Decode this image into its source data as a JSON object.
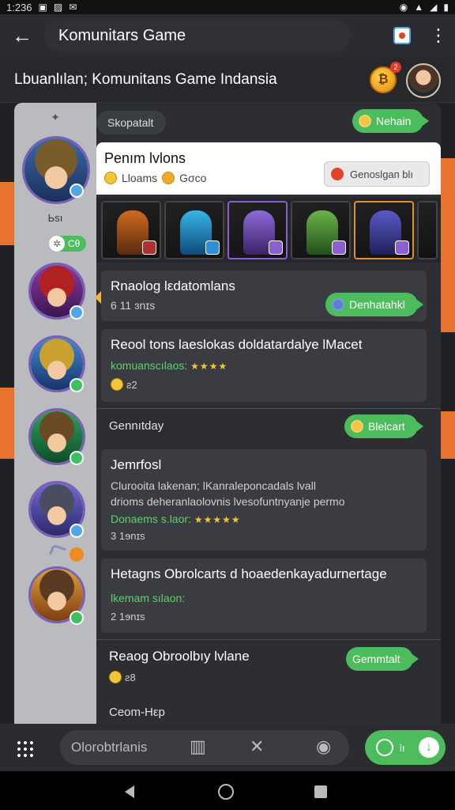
{
  "status_bar": {
    "time": "1:236"
  },
  "app_bar": {
    "title": "Komunitars Game"
  },
  "community_header": {
    "title": "Lbuanlılan;  Komunitans Game Indansia",
    "coin_badge": "2"
  },
  "rail": {
    "label": "Ьsı",
    "count": "Cθ"
  },
  "chips": {
    "top_left": "Skopatalt",
    "top_right": "Nehain",
    "ranking": "Denhatahkl",
    "birthday": "Blelcart",
    "comment": "Gemmtalt"
  },
  "header_card": {
    "title": "Penım lvlons",
    "meta_left": "Lloams",
    "meta_right": "Gσco",
    "button": "Genoslgaп blı"
  },
  "cards": [
    {
      "title": "Rnaolog lεdatomlans",
      "sub": "6 11 ɜnɪs"
    },
    {
      "title": "Reool tons laeslokas doldatardalye lMacet",
      "green": "komuanscılaos:",
      "meta": "ƨ2"
    },
    {
      "title": "Jemrfosl",
      "line1": "Clurooita lakenan; lKanraleponcadals lvall",
      "line2": "drioms deheranlaolovnis lvesofuntnyanje permo",
      "green": "Donaems s.laor:",
      "meta": "3 1ɘnɪs"
    },
    {
      "title": "Hetagns Obrolcarts d hoaedenkayadurnertage",
      "green": "lkemam sılaon:",
      "meta": "2 1ɘnɪs"
    },
    {
      "title": "Reaog Obroolbıy lvlane",
      "meta": "ƨ8"
    }
  ],
  "section_labels": {
    "birthday": "Gennıtday",
    "help": "Ceom-Нεр"
  },
  "bottom_bar": {
    "search_placeholder": "Olorobtrlanis",
    "post_label": "lı"
  },
  "colors": {
    "accent_green": "#4cbc5c",
    "orange": "#e8732c",
    "rail": "#b9bbbe"
  }
}
